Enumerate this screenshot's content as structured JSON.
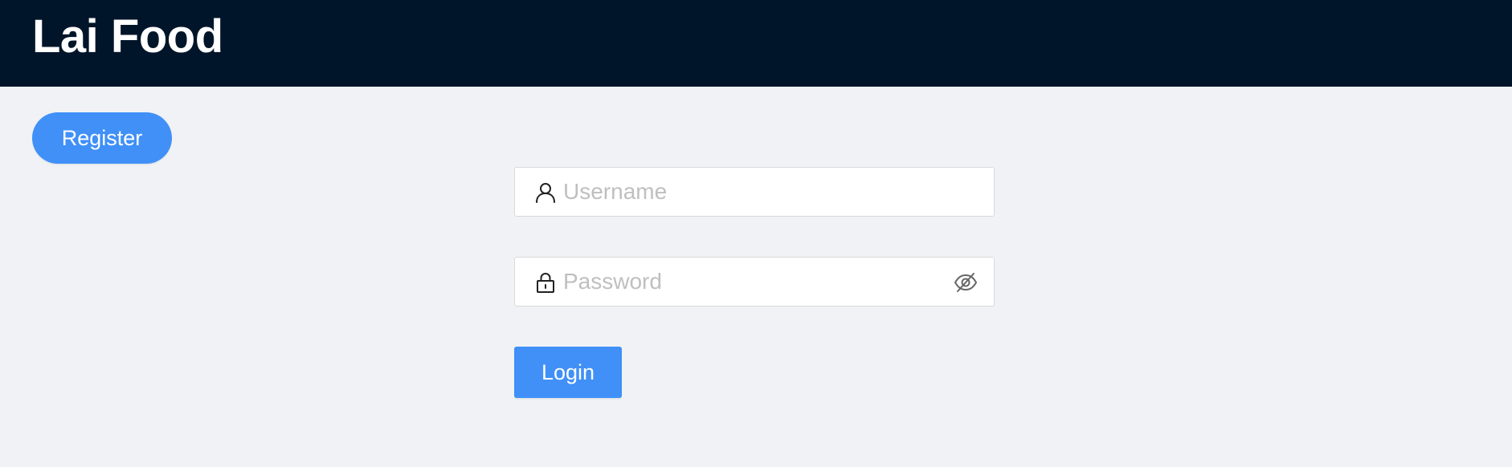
{
  "header": {
    "title": "Lai Food",
    "background_color": "#001529"
  },
  "actions": {
    "register_label": "Register",
    "login_label": "Login",
    "accent_color": "#4090f7"
  },
  "form": {
    "username": {
      "placeholder": "Username",
      "value": "",
      "icon": "user-icon"
    },
    "password": {
      "placeholder": "Password",
      "value": "",
      "icon": "lock-icon",
      "toggle_icon": "eye-invisible-icon"
    }
  }
}
